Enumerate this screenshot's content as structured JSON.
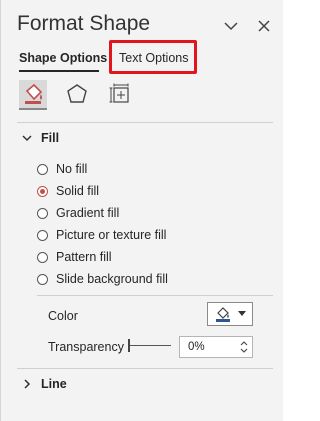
{
  "pane": {
    "title": "Format Shape",
    "tabs": [
      {
        "label": "Shape Options",
        "active": true
      },
      {
        "label": "Text Options",
        "active": false
      }
    ],
    "categories": [
      {
        "icon": "fill-line-icon",
        "active": true
      },
      {
        "icon": "effects-icon",
        "active": false
      },
      {
        "icon": "size-properties-icon",
        "active": false
      }
    ]
  },
  "fill": {
    "header": "Fill",
    "options": [
      {
        "label": "No fill",
        "checked": false
      },
      {
        "label": "Solid fill",
        "checked": true
      },
      {
        "label": "Gradient fill",
        "checked": false
      },
      {
        "label": "Picture or texture fill",
        "checked": false
      },
      {
        "label": "Pattern fill",
        "checked": false
      },
      {
        "label": "Slide background fill",
        "checked": false
      }
    ],
    "color_label": "Color",
    "transparency_label": "Transparency",
    "transparency_value": "0%"
  },
  "line": {
    "header": "Line"
  },
  "colors": {
    "accent": "#c0504d",
    "highlight": "#e0161c",
    "pane_bg": "#f3f3f3"
  }
}
